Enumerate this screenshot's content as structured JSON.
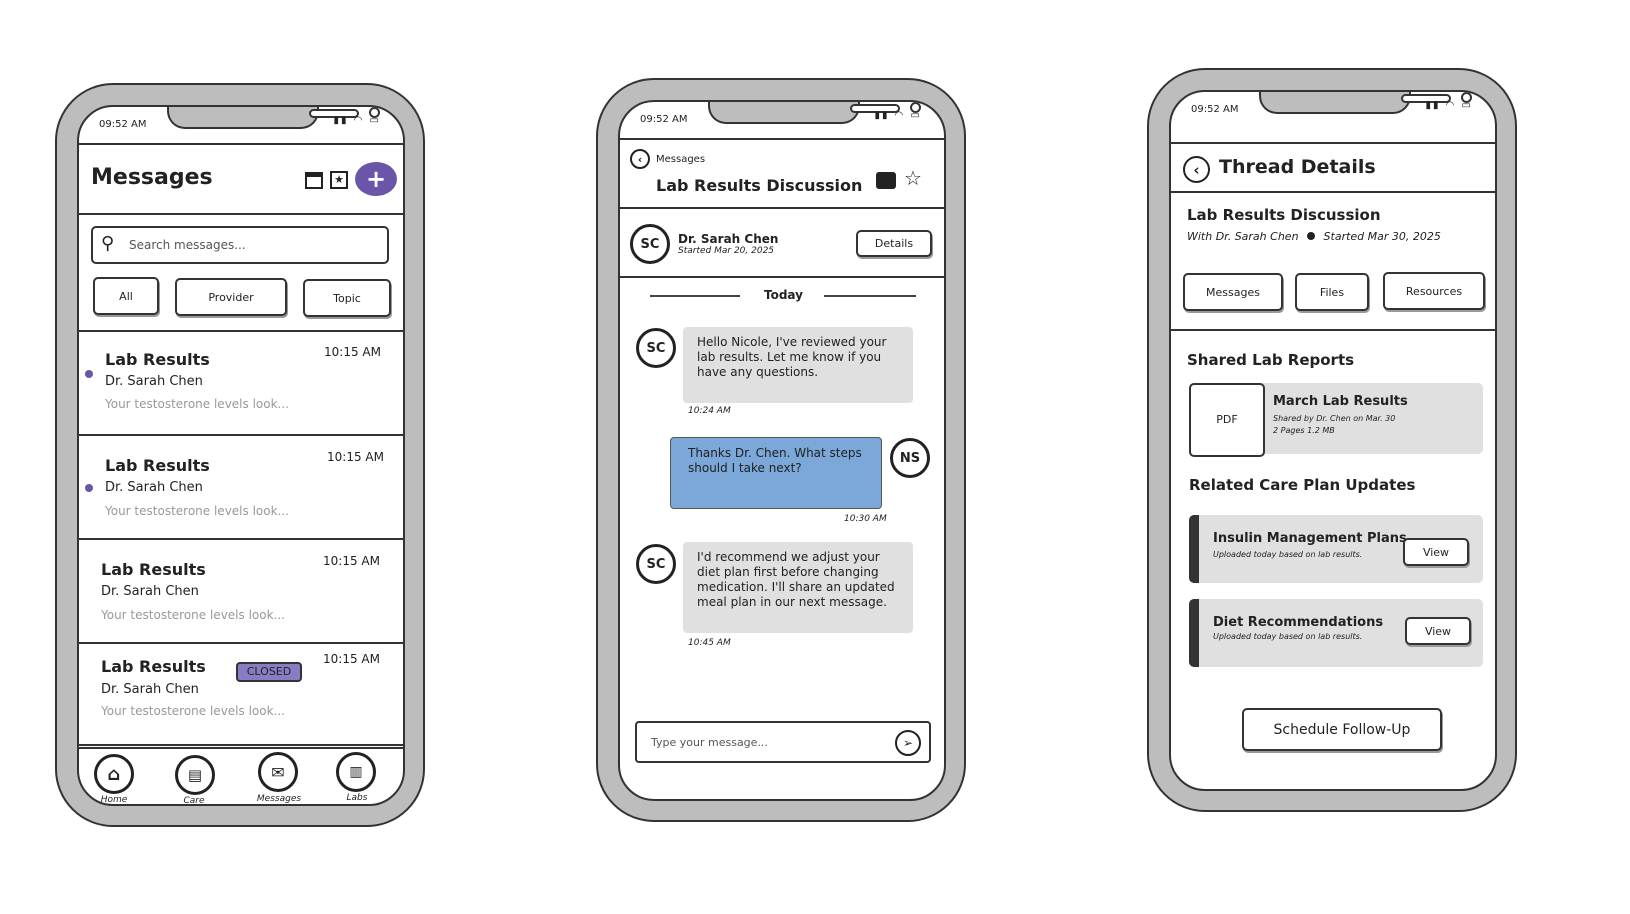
{
  "status_bar": {
    "time": "09:52 AM"
  },
  "colors": {
    "accent": "#6a55a8",
    "sent_bubble": "#7ba7d9",
    "received_bubble": "#e0e0e0",
    "badge": "#8a7cc4"
  },
  "inbox": {
    "title": "Messages",
    "icons": [
      "archive-icon",
      "starred-icon",
      "new-message-icon"
    ],
    "search_placeholder": "Search messages...",
    "filters": [
      "All",
      "Provider",
      "Topic"
    ],
    "messages": [
      {
        "title": "Lab Results",
        "sender": "Dr. Sarah Chen",
        "preview": "Your testosterone levels look...",
        "time": "10:15 AM",
        "unread": true
      },
      {
        "title": "Lab Results",
        "sender": "Dr. Sarah Chen",
        "preview": "Your testosterone levels look...",
        "time": "10:15 AM",
        "unread": true
      },
      {
        "title": "Lab Results",
        "sender": "Dr. Sarah Chen",
        "preview": "Your testosterone levels look...",
        "time": "10:15 AM",
        "unread": false
      },
      {
        "title": "Lab Results",
        "sender": "Dr. Sarah Chen",
        "preview": "Your testosterone levels look...",
        "time": "10:15 AM",
        "unread": false,
        "badge": "CLOSED"
      }
    ],
    "nav": [
      "Home",
      "Care",
      "Messages",
      "Labs"
    ]
  },
  "thread": {
    "back_label": "Messages",
    "title": "Lab Results Discussion",
    "provider_initials": "SC",
    "provider_name": "Dr. Sarah Chen",
    "started": "Started Mar 20, 2025",
    "details_label": "Details",
    "divider": "Today",
    "messages": [
      {
        "from": "SC",
        "text": "Hello Nicole, I've reviewed your lab results. Let me know if you have any questions.",
        "time": "10:24 AM"
      },
      {
        "from": "NS",
        "text": "Thanks Dr. Chen. What steps should I take next?",
        "time": "10:30 AM"
      },
      {
        "from": "SC",
        "text": "I'd recommend we adjust your diet plan first before changing medication. I'll share an updated meal plan in our next message.",
        "time": "10:45 AM"
      }
    ],
    "input_placeholder": "Type your message..."
  },
  "details": {
    "title": "Thread Details",
    "thread_title": "Lab Results Discussion",
    "with": "With Dr. Sarah Chen",
    "started": "Started Mar 30, 2025",
    "tabs": [
      "Messages",
      "Files",
      "Resources"
    ],
    "shared_heading": "Shared Lab Reports",
    "report": {
      "type": "PDF",
      "title": "March Lab Results",
      "shared": "Shared by Dr. Chen on Mar. 30",
      "meta": "2 Pages 1.2 MB"
    },
    "updates_heading": "Related Care Plan Updates",
    "updates": [
      {
        "title": "Insulin Management Plans",
        "sub": "Uploaded today based on lab results.",
        "action": "View"
      },
      {
        "title": "Diet Recommendations",
        "sub": "Uploaded today based on lab results.",
        "action": "View"
      }
    ],
    "cta": "Schedule Follow-Up"
  }
}
